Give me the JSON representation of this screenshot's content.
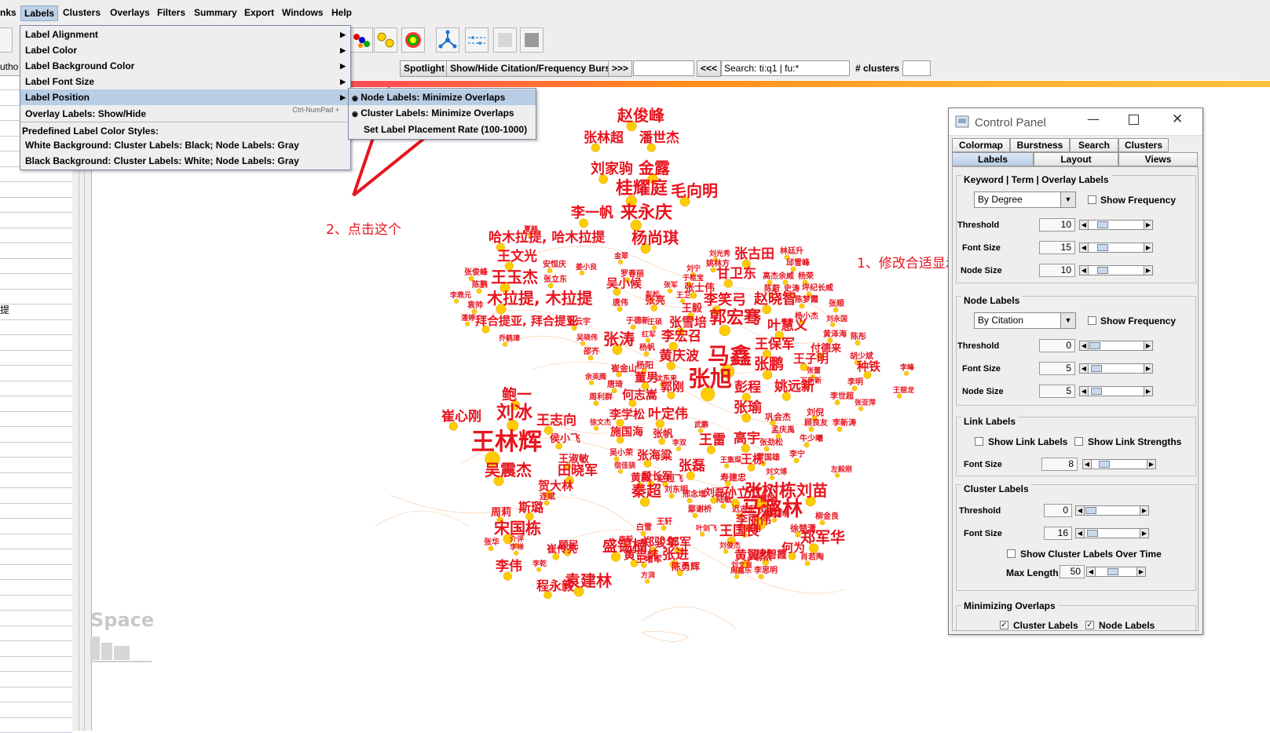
{
  "menubar": {
    "items": [
      "nks",
      "Labels",
      "Clusters",
      "Overlays",
      "Filters",
      "Summary",
      "Export",
      "Windows",
      "Help"
    ]
  },
  "labels_menu": {
    "items": [
      {
        "label": "Label Alignment",
        "submenu": true
      },
      {
        "label": "Label Color",
        "submenu": true
      },
      {
        "label": "Label Background Color",
        "submenu": true
      },
      {
        "label": "Label Font Size",
        "submenu": true
      },
      {
        "label": "Label Position",
        "submenu": true,
        "highlighted": true
      },
      {
        "label": "Overlay Labels: Show/Hide",
        "shortcut": "Ctrl-NumPad +"
      }
    ],
    "section_header": "Predefined Label Color Styles:",
    "styles": [
      "White Background: Cluster Labels: Black; Node Labels: Gray",
      "Black Background: Cluster Labels: White; Node Labels: Gray"
    ]
  },
  "position_submenu": {
    "items": [
      {
        "label": "Node Labels: Minimize Overlaps",
        "checked": true,
        "highlighted": true
      },
      {
        "label": "Cluster Labels: Minimize Overlaps",
        "checked": true
      },
      {
        "label": "Set Label Placement Rate (100-1000)",
        "checked": false
      }
    ]
  },
  "toolbar2": {
    "spotlight": "Spotlight",
    "burst": "Show/Hide Citation/Frequency Burst",
    "next": ">>>",
    "prev": "<<<",
    "search_value": "Search: ti:q1 | fu:*",
    "clusters_label": "# clusters"
  },
  "left_panel": {
    "fragment_top": "utho",
    "fragment_mid": "提"
  },
  "annotations": {
    "step1": "1、修改合适显示数量",
    "step2": "2、点击这个"
  },
  "watermark": "Space",
  "control_panel": {
    "title": "Control Panel",
    "tabs_row1": [
      "Colormap",
      "Burstness",
      "Search",
      "Clusters"
    ],
    "tabs_row2": [
      "Labels",
      "Layout",
      "Views"
    ],
    "active_tab": "Labels",
    "keyword_group": {
      "title": "Keyword | Term | Overlay Labels",
      "combo": "By Degree",
      "show_frequency": "Show Frequency",
      "threshold_label": "Threshold",
      "threshold": "10",
      "font_size_label": "Font Size",
      "font_size": "15",
      "node_size_label": "Node Size",
      "node_size": "10"
    },
    "node_group": {
      "title": "Node Labels",
      "combo": "By Citation",
      "show_frequency": "Show Frequency",
      "threshold_label": "Threshold",
      "threshold": "0",
      "font_size_label": "Font Size",
      "font_size": "5",
      "node_size_label": "Node Size",
      "node_size": "5"
    },
    "link_group": {
      "title": "Link Labels",
      "show_link_labels": "Show Link Labels",
      "show_link_strengths": "Show Link Strengths",
      "font_size_label": "Font Size",
      "font_size": "8"
    },
    "cluster_group": {
      "title": "Cluster Labels",
      "threshold_label": "Threshold",
      "threshold": "0",
      "font_size_label": "Font Size",
      "font_size": "16",
      "over_time": "Show Cluster Labels Over Time",
      "max_length_label": "Max Length",
      "max_length": "50"
    },
    "overlap_group": {
      "title": "Minimizing Overlaps",
      "cluster_labels": "Cluster Labels",
      "node_labels": "Node Labels",
      "cluster_checked": true,
      "node_checked": true
    }
  },
  "graph_labels": [
    {
      "t": "赵俊峰",
      "size": 20
    },
    {
      "t": "张林超",
      "size": 17
    },
    {
      "t": "潘世杰",
      "size": 17
    },
    {
      "t": "刘家驹",
      "size": 18
    },
    {
      "t": "金露",
      "size": 20
    },
    {
      "t": "桂耀庭",
      "size": 22
    },
    {
      "t": "毛向明",
      "size": 20
    },
    {
      "t": "李一帆",
      "size": 18
    },
    {
      "t": "来永庆",
      "size": 22
    },
    {
      "t": "夏韩",
      "size": 9
    },
    {
      "t": "哈木拉提, 哈木拉提",
      "size": 17
    },
    {
      "t": "杨尚琪",
      "size": 20
    },
    {
      "t": "王文光",
      "size": 17
    },
    {
      "t": "安恒庆",
      "size": 10
    },
    {
      "t": "金翠",
      "size": 9
    },
    {
      "t": "姜小良",
      "size": 9
    },
    {
      "t": "刘光秀",
      "size": 9
    },
    {
      "t": "姚林方",
      "size": 10
    },
    {
      "t": "张古田",
      "size": 17
    },
    {
      "t": "林廷升",
      "size": 10
    },
    {
      "t": "邱雪峰",
      "size": 10
    },
    {
      "t": "张俊峰",
      "size": 10
    },
    {
      "t": "王玉杰",
      "size": 20
    },
    {
      "t": "张立东",
      "size": 10
    },
    {
      "t": "罗春丽",
      "size": 10
    },
    {
      "t": "刘宁",
      "size": 9
    },
    {
      "t": "于枢宝",
      "size": 9
    },
    {
      "t": "甘卫东",
      "size": 17
    },
    {
      "t": "高杰",
      "size": 10
    },
    {
      "t": "余威",
      "size": 10
    },
    {
      "t": "杨荣",
      "size": 10
    },
    {
      "t": "陈鹏",
      "size": 10
    },
    {
      "t": "吴小候",
      "size": 15
    },
    {
      "t": "张军",
      "size": 9
    },
    {
      "t": "张士伟",
      "size": 13
    },
    {
      "t": "陈蔚",
      "size": 10
    },
    {
      "t": "史涛",
      "size": 10
    },
    {
      "t": "坪纪长威",
      "size": 10
    },
    {
      "t": "李鼎元",
      "size": 9
    },
    {
      "t": "木拉提, 木拉提",
      "size": 20
    },
    {
      "t": "彭松",
      "size": 9
    },
    {
      "t": "王卫",
      "size": 9
    },
    {
      "t": "李笑弓",
      "size": 18
    },
    {
      "t": "赵晓智",
      "size": 18
    },
    {
      "t": "陈梦霞",
      "size": 10
    },
    {
      "t": "张顺",
      "size": 10
    },
    {
      "t": "袁帅",
      "size": 10
    },
    {
      "t": "唐伟",
      "size": 10
    },
    {
      "t": "张亮",
      "size": 13
    },
    {
      "t": "王毅",
      "size": 13
    },
    {
      "t": "杨小杰",
      "size": 10
    },
    {
      "t": "潘婷",
      "size": 9
    },
    {
      "t": "拜合提亚, 拜合提亚",
      "size": 15
    },
    {
      "t": "张云宇",
      "size": 10
    },
    {
      "t": "于德新",
      "size": 10
    },
    {
      "t": "王硕",
      "size": 9
    },
    {
      "t": "张雪培",
      "size": 16
    },
    {
      "t": "郭宏骞",
      "size": 22
    },
    {
      "t": "叶慧义",
      "size": 17
    },
    {
      "t": "刘永国",
      "size": 9
    },
    {
      "t": "吴晓伟",
      "size": 9
    },
    {
      "t": "红军",
      "size": 9
    },
    {
      "t": "李宏召",
      "size": 17
    },
    {
      "t": "黄泽海",
      "size": 10
    },
    {
      "t": "陈彤",
      "size": 10
    },
    {
      "t": "乔鹤璋",
      "size": 9
    },
    {
      "t": "张涛",
      "size": 20
    },
    {
      "t": "杨帆",
      "size": 10
    },
    {
      "t": "王保军",
      "size": 17
    },
    {
      "t": "付德来",
      "size": 13
    },
    {
      "t": "邵齐",
      "size": 10
    },
    {
      "t": "黄庆波",
      "size": 17
    },
    {
      "t": "马鑫",
      "size": 28
    },
    {
      "t": "王子明",
      "size": 15
    },
    {
      "t": "胡少斌",
      "size": 10
    },
    {
      "t": "杨阳",
      "size": 11
    },
    {
      "t": "张鹏",
      "size": 19
    },
    {
      "t": "崔金山",
      "size": 11
    },
    {
      "t": "张蕾",
      "size": 9
    },
    {
      "t": "种铁",
      "size": 15
    },
    {
      "t": "李峰",
      "size": 9
    },
    {
      "t": "余英腾",
      "size": 9
    },
    {
      "t": "董男",
      "size": 15
    },
    {
      "t": "沈东来",
      "size": 9
    },
    {
      "t": "张旭",
      "size": 28
    },
    {
      "t": "姚远新",
      "size": 17
    },
    {
      "t": "万新新",
      "size": 9
    },
    {
      "t": "李明",
      "size": 10
    },
    {
      "t": "唐琦",
      "size": 10
    },
    {
      "t": "郭刚",
      "size": 15
    },
    {
      "t": "彭程",
      "size": 17
    },
    {
      "t": "李世超",
      "size": 10
    },
    {
      "t": "王丽龙",
      "size": 9
    },
    {
      "t": "周利群",
      "size": 10
    },
    {
      "t": "何志嵩",
      "size": 15
    },
    {
      "t": "鲍一",
      "size": 19
    },
    {
      "t": "张亚萍",
      "size": 9
    },
    {
      "t": "崔心刚",
      "size": 17
    },
    {
      "t": "刘冰",
      "size": 23
    },
    {
      "t": "王志向",
      "size": 17
    },
    {
      "t": "李学松",
      "size": 15
    },
    {
      "t": "叶定伟",
      "size": 17
    },
    {
      "t": "张瑜",
      "size": 18
    },
    {
      "t": "巩会杰",
      "size": 11
    },
    {
      "t": "刘倪",
      "size": 11
    },
    {
      "t": "徐文杰",
      "size": 9
    },
    {
      "t": "武鹏",
      "size": 9
    },
    {
      "t": "顾良友",
      "size": 10
    },
    {
      "t": "李新涛",
      "size": 10
    },
    {
      "t": "王林辉",
      "size": 30
    },
    {
      "t": "侯小飞",
      "size": 13
    },
    {
      "t": "施国海",
      "size": 14
    },
    {
      "t": "张帆",
      "size": 13
    },
    {
      "t": "孟庆禹",
      "size": 10
    },
    {
      "t": "牛少曦",
      "size": 10
    },
    {
      "t": "李双",
      "size": 9
    },
    {
      "t": "王雷",
      "size": 17
    },
    {
      "t": "高宇",
      "size": 17
    },
    {
      "t": "张劲松",
      "size": 10
    },
    {
      "t": "王淑敏",
      "size": 13
    },
    {
      "t": "吴小荣",
      "size": 10
    },
    {
      "t": "张海粱",
      "size": 15
    },
    {
      "t": "王集琛",
      "size": 9
    },
    {
      "t": "王栋",
      "size": 15
    },
    {
      "t": "罗国雄",
      "size": 10
    },
    {
      "t": "李宁",
      "size": 10
    },
    {
      "t": "吴震杰",
      "size": 20
    },
    {
      "t": "田晓军",
      "size": 17
    },
    {
      "t": "宿佳骁",
      "size": 9
    },
    {
      "t": "张磊",
      "size": 17
    },
    {
      "t": "左毅刚",
      "size": 9
    },
    {
      "t": "黄毅",
      "size": 13
    },
    {
      "t": "殷长军",
      "size": 13
    },
    {
      "t": "赵超飞",
      "size": 11
    },
    {
      "t": "寿建忠",
      "size": 11
    },
    {
      "t": "刘文博",
      "size": 9
    },
    {
      "t": "刘苗",
      "size": 20
    },
    {
      "t": "张树栋",
      "size": 22
    },
    {
      "t": "贺大林",
      "size": 15
    },
    {
      "t": "秦超",
      "size": 19
    },
    {
      "t": "刘东明",
      "size": 10
    },
    {
      "t": "邢念增",
      "size": 10
    },
    {
      "t": "刘磊",
      "size": 13
    },
    {
      "t": "孙立江",
      "size": 17
    },
    {
      "t": "连斌",
      "size": 10
    },
    {
      "t": "鄢谢桥",
      "size": 10
    },
    {
      "t": "陆敏",
      "size": 10
    },
    {
      "t": "马潞林",
      "size": 26
    },
    {
      "t": "曹强",
      "size": 10
    },
    {
      "t": "周莉",
      "size": 13
    },
    {
      "t": "斯璐",
      "size": 16
    },
    {
      "t": "迟志宏",
      "size": 10
    },
    {
      "t": "刘承",
      "size": 11
    },
    {
      "t": "王宗明",
      "size": 9
    },
    {
      "t": "宋国栋",
      "size": 20
    },
    {
      "t": "王轩",
      "size": 10
    },
    {
      "t": "白雪",
      "size": 10
    },
    {
      "t": "叶剑飞",
      "size": 9
    },
    {
      "t": "李丽伟",
      "size": 15
    },
    {
      "t": "柳金良",
      "size": 10
    },
    {
      "t": "介评",
      "size": 9
    },
    {
      "t": "盛锡楠",
      "size": 19
    },
    {
      "t": "崔传亮",
      "size": 13
    },
    {
      "t": "王国良",
      "size": 17
    },
    {
      "t": "郑军华",
      "size": 19
    },
    {
      "t": "张华",
      "size": 10
    },
    {
      "t": "郑骏年",
      "size": 15
    },
    {
      "t": "李毅",
      "size": 9
    },
    {
      "t": "郭军",
      "size": 15
    },
    {
      "t": "毛丽丽",
      "size": 10
    },
    {
      "t": "徐楚潇",
      "size": 11
    },
    {
      "t": "何为",
      "size": 15
    },
    {
      "t": "李禅",
      "size": 9
    },
    {
      "t": "顾民",
      "size": 13
    },
    {
      "t": "黄吉炜",
      "size": 15
    },
    {
      "t": "张进",
      "size": 17
    },
    {
      "t": "刘俊杰",
      "size": 9
    },
    {
      "t": "黄翼然",
      "size": 16
    },
    {
      "t": "唐碧霞",
      "size": 13
    },
    {
      "t": "肖若陶",
      "size": 10
    },
    {
      "t": "李伟",
      "size": 17
    },
    {
      "t": "李乾",
      "size": 9
    },
    {
      "t": "王增军",
      "size": 11
    },
    {
      "t": "陈勇辉",
      "size": 12
    },
    {
      "t": "刘文良",
      "size": 9
    },
    {
      "t": "方湃",
      "size": 9
    },
    {
      "t": "周嘉乐",
      "size": 9
    },
    {
      "t": "李思明",
      "size": 10
    },
    {
      "t": "程永毅",
      "size": 16
    },
    {
      "t": "袁建林",
      "size": 20
    }
  ]
}
